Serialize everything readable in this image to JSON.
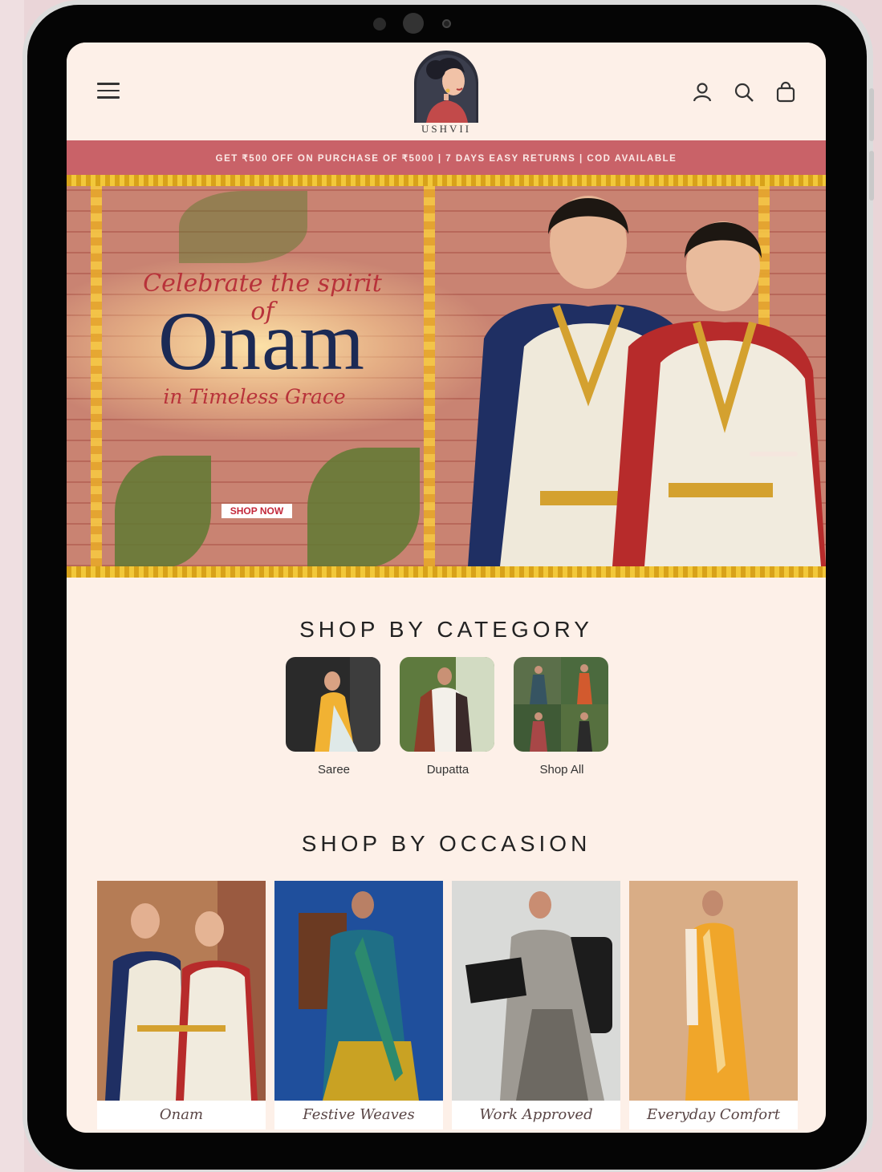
{
  "brand": {
    "name": "USHVII"
  },
  "announcement": "GET ₹500 OFF ON PURCHASE OF ₹5000 | 7 DAYS EASY RETURNS | COD AVAILABLE",
  "hero": {
    "script_line_1": "Celebrate the spirit of",
    "headline": "Onam",
    "script_line_2": "in Timeless Grace",
    "cta_label": "SHOP NOW"
  },
  "categories": {
    "title": "SHOP BY CATEGORY",
    "items": [
      {
        "label": "Saree"
      },
      {
        "label": "Dupatta"
      },
      {
        "label": "Shop All"
      }
    ]
  },
  "occasions": {
    "title": "SHOP BY OCCASION",
    "items": [
      {
        "label": "Onam"
      },
      {
        "label": "Festive Weaves"
      },
      {
        "label": "Work Approved"
      },
      {
        "label": "Everyday Comfort"
      }
    ]
  },
  "icons": [
    "hamburger-menu-icon",
    "account-icon",
    "search-icon",
    "shopping-bag-icon"
  ],
  "colors": {
    "page_bg": "#fdf0e8",
    "announcement_bg": "#c96268",
    "headline": "#1b2a55",
    "script_accent": "#b8323a"
  }
}
